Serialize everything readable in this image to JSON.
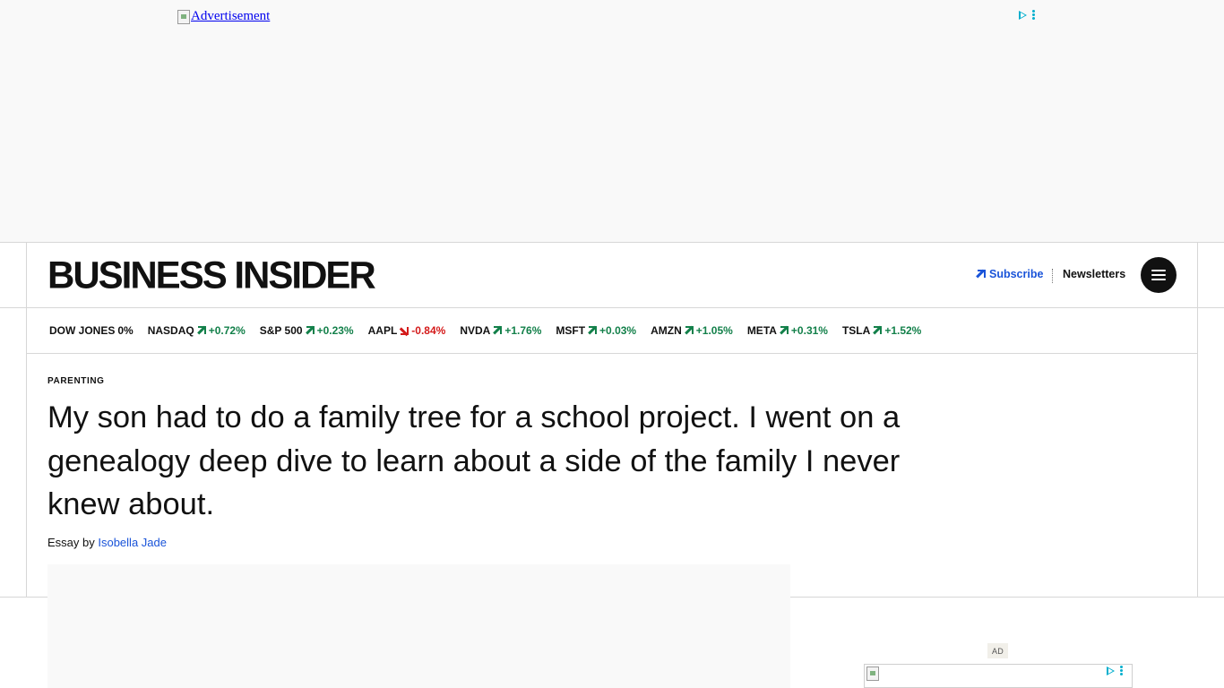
{
  "top_ad": {
    "alt_text": "Advertisement",
    "adchoices_icon": "adchoices-play-icon",
    "menu_icon": "vertical-dots-icon"
  },
  "header": {
    "logo": "BUSINESS INSIDER",
    "subscribe_label": "Subscribe",
    "subscribe_icon": "arrow-up-right-icon",
    "newsletters_label": "Newsletters",
    "menu_icon": "hamburger-menu-icon"
  },
  "colors": {
    "accent": "#1a54d9",
    "up": "#13804a",
    "down": "#d41a1a",
    "ink": "#111111"
  },
  "ticker": [
    {
      "symbol": "DOW JONES",
      "change": "0%",
      "direction": "flat"
    },
    {
      "symbol": "NASDAQ",
      "change": "+0.72%",
      "direction": "up"
    },
    {
      "symbol": "S&P 500",
      "change": "+0.23%",
      "direction": "up"
    },
    {
      "symbol": "AAPL",
      "change": "-0.84%",
      "direction": "down"
    },
    {
      "symbol": "NVDA",
      "change": "+1.76%",
      "direction": "up"
    },
    {
      "symbol": "MSFT",
      "change": "+0.03%",
      "direction": "up"
    },
    {
      "symbol": "AMZN",
      "change": "+1.05%",
      "direction": "up"
    },
    {
      "symbol": "META",
      "change": "+0.31%",
      "direction": "up"
    },
    {
      "symbol": "TSLA",
      "change": "+1.52%",
      "direction": "up"
    }
  ],
  "article": {
    "category": "PARENTING",
    "headline": "My son had to do a family tree for a school project. I went on a genealogy deep dive to learn about a side of the family I never knew about.",
    "byline_prefix": "Essay by",
    "author": "Isobella Jade"
  },
  "side_ad": {
    "label": "AD"
  }
}
